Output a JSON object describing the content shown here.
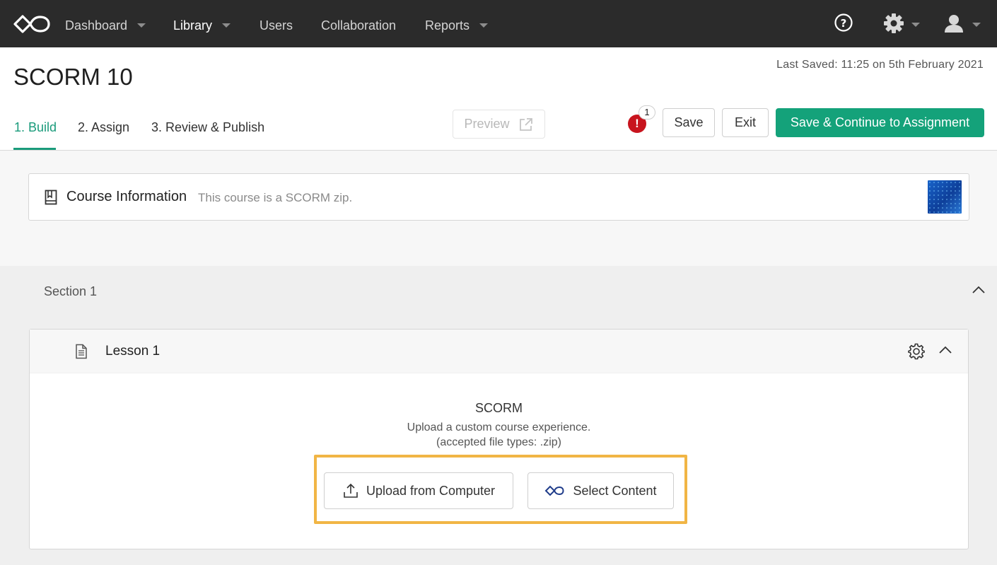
{
  "nav": {
    "items": [
      {
        "label": "Dashboard",
        "has_menu": true
      },
      {
        "label": "Library",
        "has_menu": true,
        "active": true
      },
      {
        "label": "Users",
        "has_menu": false
      },
      {
        "label": "Collaboration",
        "has_menu": false
      },
      {
        "label": "Reports",
        "has_menu": true
      }
    ],
    "icons": [
      "help-icon",
      "gear-icon",
      "user-icon"
    ]
  },
  "header": {
    "title": "SCORM 10",
    "last_saved": "Last Saved: 11:25 on 5th February 2021",
    "tabs": [
      {
        "label": "1. Build",
        "active": true
      },
      {
        "label": "2. Assign"
      },
      {
        "label": "3. Review & Publish"
      }
    ],
    "preview_label": "Preview",
    "alert_symbol": "!",
    "alert_count": "1",
    "save_label": "Save",
    "exit_label": "Exit",
    "continue_label": "Save & Continue to Assignment"
  },
  "course_info": {
    "title": "Course Information",
    "description": "This course is a SCORM zip."
  },
  "section": {
    "title": "Section 1",
    "lesson": {
      "title": "Lesson 1",
      "content_type": "SCORM",
      "description": "Upload a custom course experience.",
      "accepted_types": "(accepted file types: .zip)",
      "upload_label": "Upload from Computer",
      "select_label": "Select Content"
    }
  },
  "colors": {
    "accent": "#14a27a",
    "nav_bg": "#2b2b2b",
    "alert": "#c8141e",
    "highlight": "#f1b545"
  }
}
